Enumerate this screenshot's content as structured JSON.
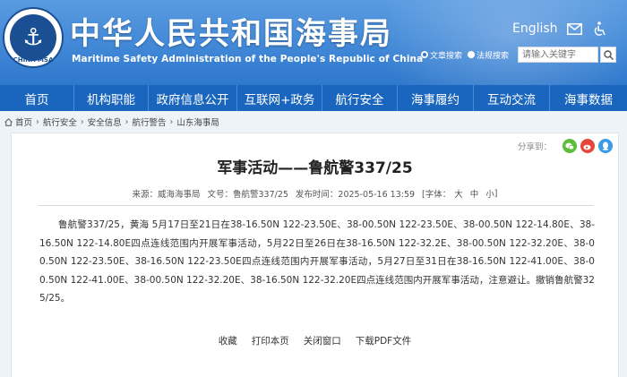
{
  "header": {
    "site_title": "中华人民共和国海事局",
    "site_subtitle": "Maritime Safety Administration of the People's Republic of China",
    "logo_text": "CHINA MSA",
    "lang_link": "English",
    "search": {
      "option1": "文章搜索",
      "option2": "法规搜索",
      "placeholder": "请输入关键字"
    }
  },
  "nav": {
    "items": [
      "首页",
      "机构职能",
      "政府信息公开",
      "互联网+政务",
      "航行安全",
      "海事履约",
      "互动交流",
      "海事数据"
    ]
  },
  "breadcrumb": {
    "items": [
      "首页",
      "航行安全",
      "安全信息",
      "航行警告",
      "山东海事局"
    ]
  },
  "article": {
    "share_label": "分享到：",
    "title": "军事活动——鲁航警337/25",
    "meta": {
      "source": "来源：威海海事局",
      "doc_no": "文号：鲁航警337/25",
      "published": "发布时间：2025-05-16 13:59",
      "font_label": "[字体：",
      "font_large": "大",
      "font_medium": "中",
      "font_small": "小",
      "font_close": "]"
    },
    "body": "鲁航警337/25，黄海 5月17日至21日在38-16.50N 122-23.50E、38-00.50N 122-23.50E、38-00.50N 122-14.80E、38-16.50N 122-14.80E四点连线范围内开展军事活动，5月22日至26日在38-16.50N 122-32.2E、38-00.50N 122-32.20E、38-00.50N 122-23.50E、38-16.50N 122-23.50E四点连线范围内开展军事活动，5月27日至31日在38-16.50N 122-41.00E、38-00.50N 122-41.00E、38-00.50N 122-32.20E、38-16.50N 122-32.20E四点连线范围内开展军事活动，注意避让。撤销鲁航警325/25。",
    "actions": [
      "收藏",
      "打印本页",
      "关闭窗口",
      "下载PDF文件"
    ]
  },
  "colors": {
    "header_blue": "#3f86d6",
    "nav_blue": "#1a66bf",
    "wechat_green": "#5bbf3c",
    "weibo_red": "#e6463c",
    "qq_blue": "#3a9be8"
  }
}
